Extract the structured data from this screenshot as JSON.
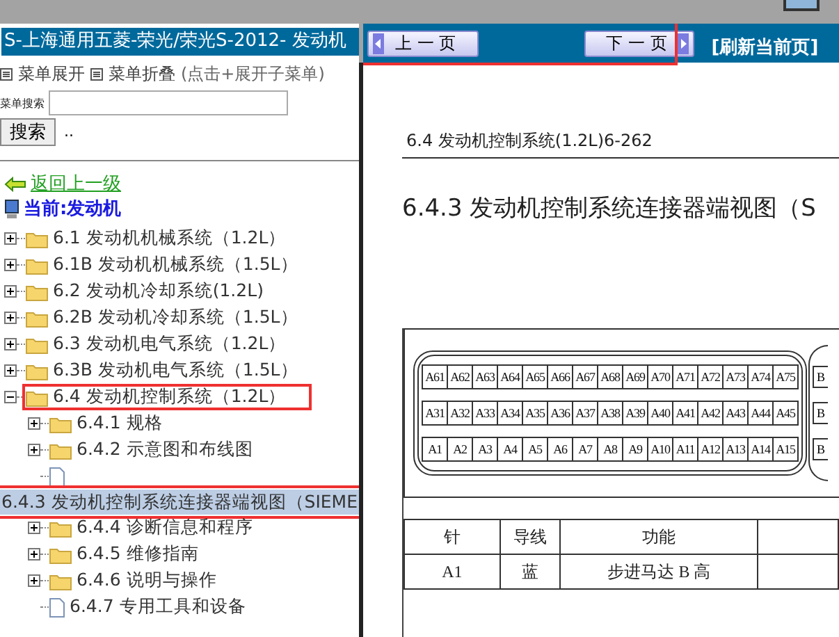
{
  "sidebar": {
    "title": "S-上海通用五菱-荣光/荣光S-2012- 发动机",
    "menu_toggles": [
      {
        "label": "菜单展开"
      },
      {
        "label": "菜单折叠",
        "hint": "(点击+展开子菜单)"
      }
    ],
    "search": {
      "label": "菜单搜索",
      "button": "搜索",
      "trail": ".."
    },
    "back_link": "返回上一级",
    "current": "当前:发动机",
    "tree": [
      {
        "label": "6.1 发动机机械系统（1.2L）",
        "kind": "folder",
        "expanded": false,
        "selected": false
      },
      {
        "label": "6.1B 发动机机械系统（1.5L）",
        "kind": "folder",
        "expanded": false,
        "selected": false
      },
      {
        "label": "6.2 发动机冷却系统(1.2L)",
        "kind": "folder",
        "expanded": false,
        "selected": false
      },
      {
        "label": "6.2B 发动机冷却系统（1.5L）",
        "kind": "folder",
        "expanded": false,
        "selected": false
      },
      {
        "label": "6.3 发动机电气系统（1.2L）",
        "kind": "folder",
        "expanded": false,
        "selected": false
      },
      {
        "label": "6.3B 发动机电气系统（1.5L）",
        "kind": "folder",
        "expanded": false,
        "selected": false
      },
      {
        "label": "6.4 发动机控制系统（1.2L）",
        "kind": "folder",
        "expanded": true,
        "selected": false,
        "highlighted": true,
        "children": [
          {
            "label": "6.4.1 规格",
            "kind": "folder",
            "expanded": false,
            "selected": false
          },
          {
            "label": "6.4.2 示意图和布线图",
            "kind": "folder",
            "expanded": false,
            "selected": false
          },
          {
            "label": "6.4.3 发动机控制系统连接器端视图（SIEME",
            "kind": "page",
            "selected": true,
            "highlighted": true
          },
          {
            "label": "6.4.4 诊断信息和程序",
            "kind": "folder",
            "expanded": false,
            "selected": false
          },
          {
            "label": "6.4.5 维修指南",
            "kind": "folder",
            "expanded": false,
            "selected": false
          },
          {
            "label": "6.4.6 说明与操作",
            "kind": "folder",
            "expanded": false,
            "selected": false
          },
          {
            "label": "6.4.7 专用工具和设备",
            "kind": "page",
            "selected": false
          }
        ]
      }
    ]
  },
  "nav": {
    "prev": "上 一 页",
    "next": "下 一 页",
    "refresh": "[刷新当前页]",
    "highlighted": true
  },
  "document": {
    "page_header": "6.4 发动机控制系统(1.2L)6-262",
    "heading": "6.4.3 发动机控制系统连接器端视图（S",
    "connector_rows": [
      [
        "A61",
        "A62",
        "A63",
        "A64",
        "A65",
        "A66",
        "A67",
        "A68",
        "A69",
        "A70",
        "A71",
        "A72",
        "A73",
        "A74",
        "A75"
      ],
      [
        "A31",
        "A32",
        "A33",
        "A34",
        "A35",
        "A36",
        "A37",
        "A38",
        "A39",
        "A40",
        "A41",
        "A42",
        "A43",
        "A44",
        "A45"
      ],
      [
        "A1",
        "A2",
        "A3",
        "A4",
        "A5",
        "A6",
        "A7",
        "A8",
        "A9",
        "A10",
        "A11",
        "A12",
        "A13",
        "A14",
        "A15"
      ]
    ],
    "second_connector_rows": [
      "B",
      "B",
      "B"
    ],
    "table": {
      "columns": [
        "针",
        "导线",
        "功能"
      ],
      "rows": [
        [
          "A1",
          "蓝",
          "步进马达 B 高"
        ]
      ]
    }
  }
}
